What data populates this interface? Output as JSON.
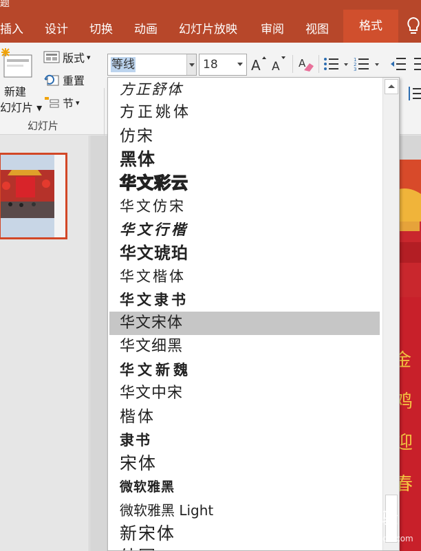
{
  "ribbon_tabs": {
    "partial_left": "题",
    "insert": "插入",
    "design": "设计",
    "transitions": "切换",
    "animations": "动画",
    "slideshow": "幻灯片放映",
    "review": "审阅",
    "view": "视图",
    "format": "格式"
  },
  "slides_group": {
    "new_slide_line1": "新建",
    "new_slide_line2": "幻灯片",
    "layout": "版式",
    "reset": "重置",
    "section": "节",
    "group_label": "幻灯片"
  },
  "font": {
    "current_font": "等线",
    "current_size": "18"
  },
  "font_list": [
    {
      "name": "方正舒体",
      "family": "\"DejaVu Serif\", serif",
      "size": 21,
      "weight": "normal",
      "style": "italic",
      "spacing": 2
    },
    {
      "name": "方正姚体",
      "family": "\"DejaVu Sans\", sans-serif",
      "size": 22,
      "weight": "normal",
      "style": "normal",
      "spacing": 4
    },
    {
      "name": "仿宋",
      "family": "\"DejaVu Serif\", serif",
      "size": 23,
      "weight": "normal",
      "style": "normal",
      "spacing": 2
    },
    {
      "name": "黑体",
      "family": "\"DejaVu Sans\", sans-serif",
      "size": 25,
      "weight": "bold",
      "style": "normal",
      "spacing": 1
    },
    {
      "name": "华文彩云",
      "family": "\"DejaVu Sans\", sans-serif",
      "size": 24,
      "weight": "bold",
      "style": "normal",
      "spacing": 1,
      "outline": true
    },
    {
      "name": "华文仿宋",
      "family": "\"DejaVu Serif\", serif",
      "size": 21,
      "weight": "normal",
      "style": "normal",
      "spacing": 3
    },
    {
      "name": "华文行楷",
      "family": "\"DejaVu Serif\", serif",
      "size": 21,
      "weight": "bold",
      "style": "italic",
      "spacing": 4
    },
    {
      "name": "华文琥珀",
      "family": "\"DejaVu Sans\", sans-serif",
      "size": 24,
      "weight": "bold",
      "style": "normal",
      "spacing": 1
    },
    {
      "name": "华文楷体",
      "family": "\"DejaVu Serif\", serif",
      "size": 21,
      "weight": "normal",
      "style": "normal",
      "spacing": 3
    },
    {
      "name": "华文隶书",
      "family": "\"DejaVu Serif\", serif",
      "size": 21,
      "weight": "bold",
      "style": "normal",
      "spacing": 4
    },
    {
      "name": "华文宋体",
      "family": "\"DejaVu Serif\", serif",
      "size": 22,
      "weight": "normal",
      "style": "normal",
      "spacing": 1,
      "highlighted": true
    },
    {
      "name": "华文细黑",
      "family": "\"DejaVu Sans\", sans-serif",
      "size": 22,
      "weight": "normal",
      "style": "normal",
      "spacing": 1
    },
    {
      "name": "华文新魏",
      "family": "\"DejaVu Serif\", serif",
      "size": 21,
      "weight": "bold",
      "style": "normal",
      "spacing": 5
    },
    {
      "name": "华文中宋",
      "family": "\"DejaVu Serif\", serif",
      "size": 22,
      "weight": "normal",
      "style": "normal",
      "spacing": 1
    },
    {
      "name": "楷体",
      "family": "\"DejaVu Serif\", serif",
      "size": 23,
      "weight": "normal",
      "style": "normal",
      "spacing": 3
    },
    {
      "name": "隶书",
      "family": "\"DejaVu Serif\", serif",
      "size": 21,
      "weight": "bold",
      "style": "normal",
      "spacing": 2
    },
    {
      "name": "宋体",
      "family": "\"DejaVu Serif\", serif",
      "size": 25,
      "weight": "normal",
      "style": "normal",
      "spacing": 2
    },
    {
      "name": "微软雅黑",
      "family": "\"DejaVu Sans\", sans-serif",
      "size": 19,
      "weight": "bold",
      "style": "normal",
      "spacing": 1
    },
    {
      "name": "微软雅黑 Light",
      "family": "\"DejaVu Sans\", sans-serif",
      "size": 20,
      "weight": "normal",
      "style": "normal",
      "spacing": 0
    },
    {
      "name": "新宋体",
      "family": "\"DejaVu Serif\", serif",
      "size": 25,
      "weight": "normal",
      "style": "normal",
      "spacing": 2
    },
    {
      "name": "幼圆",
      "family": "\"DejaVu Sans\", sans-serif",
      "size": 25,
      "weight": "normal",
      "style": "normal",
      "spacing": 2
    }
  ],
  "colors": {
    "ribbon_bar": "#b7472a",
    "active_tab": "#d04f2d",
    "selection": "#bcd4ee",
    "hover_item": "#c6c6c6"
  },
  "watermark": "Bai度 经验 jingyan.baidu.com"
}
